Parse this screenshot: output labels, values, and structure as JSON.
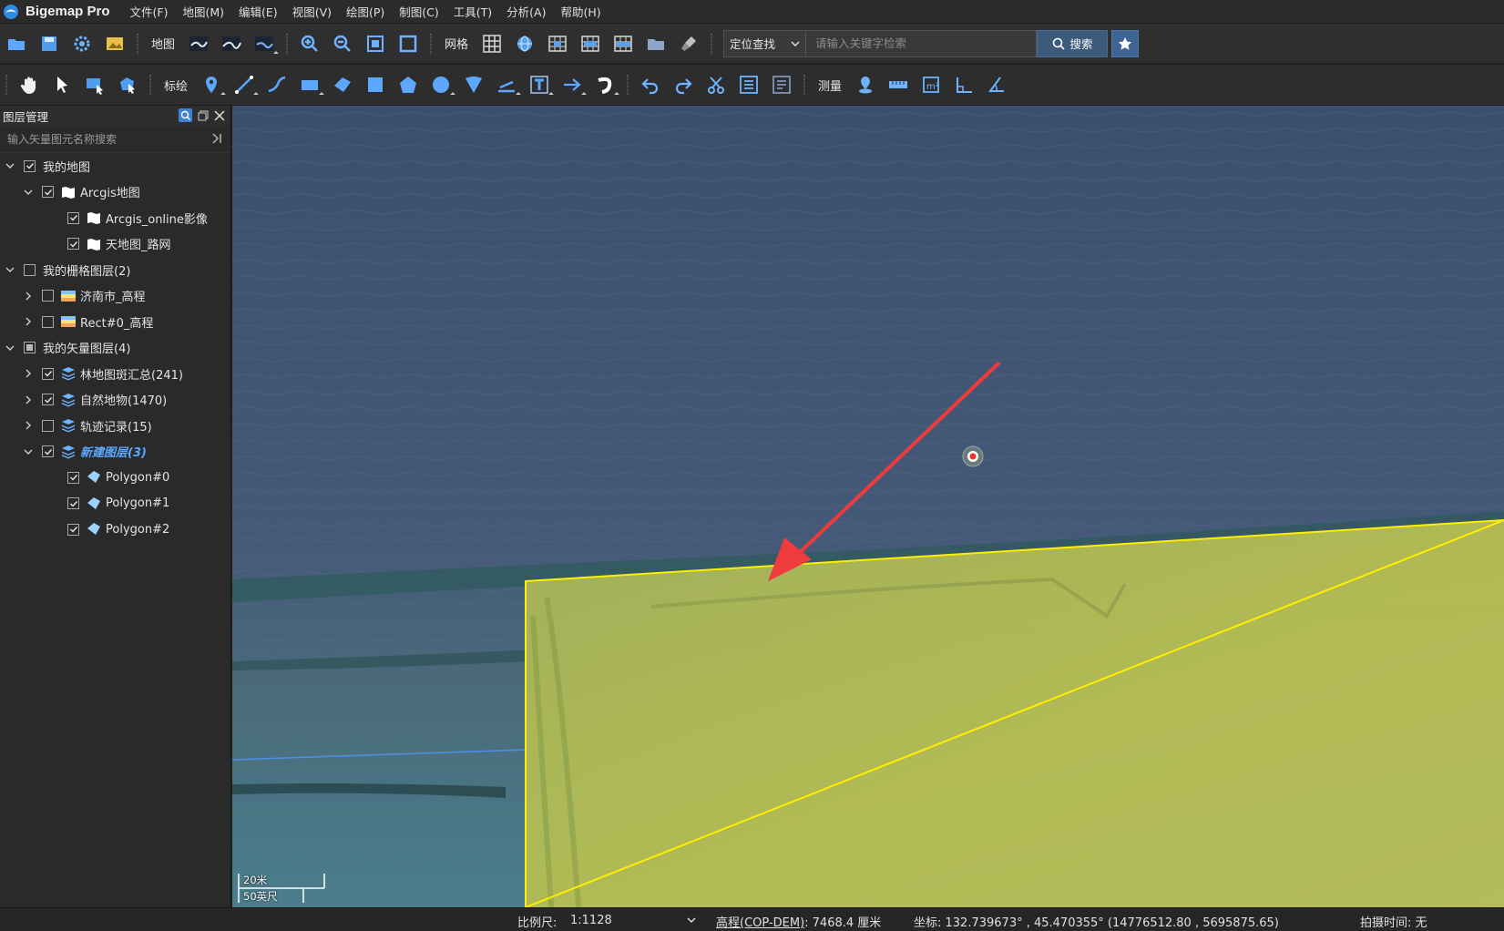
{
  "app": {
    "title": "Bigemap Pro",
    "logo_icon": "bigemap-logo-icon"
  },
  "menu": [
    "文件(F)",
    "地图(M)",
    "编辑(E)",
    "视图(V)",
    "绘图(P)",
    "制图(C)",
    "工具(T)",
    "分析(A)",
    "帮助(H)"
  ],
  "toolbar1": {
    "map_label": "地图",
    "grid_label": "网格",
    "search": {
      "type": "定位查找",
      "placeholder": "请输入关键字检索",
      "button": "搜索"
    }
  },
  "toolbar2": {
    "draw_label": "标绘",
    "measure_label": "测量"
  },
  "layer_panel": {
    "title": "图层管理",
    "search_placeholder": "输入矢量图元名称搜索",
    "tree": [
      {
        "label": "我的地图",
        "level": 0,
        "expanded": true,
        "checked": true,
        "icon": "none"
      },
      {
        "label": "Arcgis地图",
        "level": 1,
        "expanded": true,
        "checked": true,
        "icon": "map-icon"
      },
      {
        "label": "Arcgis_online影像",
        "level": 2,
        "checked": true,
        "icon": "map-icon"
      },
      {
        "label": "天地图_路网",
        "level": 2,
        "checked": true,
        "icon": "map-icon"
      },
      {
        "label": "我的栅格图层(2)",
        "level": 0,
        "expanded": true,
        "checked": false,
        "icon": "none"
      },
      {
        "label": "济南市_高程",
        "level": 1,
        "expanded": false,
        "checked": false,
        "icon": "raster-icon"
      },
      {
        "label": "Rect#0_高程",
        "level": 1,
        "expanded": false,
        "checked": false,
        "icon": "raster-icon"
      },
      {
        "label": "我的矢量图层(4)",
        "level": 0,
        "expanded": true,
        "checked": "partial",
        "icon": "none"
      },
      {
        "label": "林地图斑汇总(241)",
        "level": 1,
        "expanded": false,
        "checked": true,
        "icon": "layers-icon"
      },
      {
        "label": "自然地物(1470)",
        "level": 1,
        "expanded": false,
        "checked": true,
        "icon": "layers-icon"
      },
      {
        "label": "轨迹记录(15)",
        "level": 1,
        "expanded": false,
        "checked": false,
        "icon": "layers-icon"
      },
      {
        "label": "新建图层(3)",
        "level": 1,
        "expanded": true,
        "checked": true,
        "icon": "layers-icon",
        "active": true
      },
      {
        "label": "Polygon#0",
        "level": 2,
        "checked": true,
        "icon": "polygon-icon"
      },
      {
        "label": "Polygon#1",
        "level": 2,
        "checked": true,
        "icon": "polygon-icon"
      },
      {
        "label": "Polygon#2",
        "level": 2,
        "checked": true,
        "icon": "polygon-icon"
      }
    ]
  },
  "map": {
    "scale_bar": {
      "metric": "20米",
      "imperial": "50英尺"
    },
    "polygon_color": "#d4df3a",
    "outline_color": "#ffee00",
    "arrow_color": "#ee3b3b"
  },
  "status": {
    "scale_label": "比例尺:",
    "scale_value": "1:1128",
    "elevation_source": "高程(COP-DEM)",
    "elevation_value": ": 7468.4 厘米",
    "coordinates": "坐标: 132.739673° , 45.470355°  (14776512.80 , 5695875.65)",
    "capture_time": "拍摄时间: 无"
  }
}
